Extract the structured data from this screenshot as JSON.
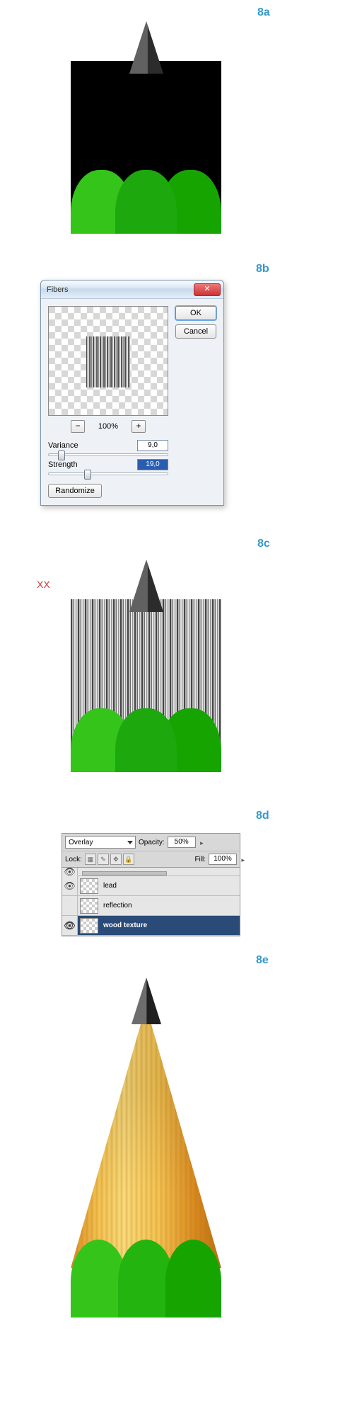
{
  "steps": {
    "a": "8a",
    "b": "8b",
    "c": "8c",
    "d": "8d",
    "e": "8e"
  },
  "annotation": {
    "xx": "XX"
  },
  "fibers_dialog": {
    "title": "Fibers",
    "close_glyph": "✕",
    "ok": "OK",
    "cancel": "Cancel",
    "zoom_minus": "−",
    "zoom_plus": "+",
    "zoom_value": "100%",
    "variance_label": "Variance",
    "variance_value": "9,0",
    "variance_thumb_pct": 8,
    "strength_label": "Strength",
    "strength_value": "19,0",
    "strength_thumb_pct": 30,
    "randomize": "Randomize"
  },
  "layers_panel": {
    "blend_mode": "Overlay",
    "opacity_label": "Opacity:",
    "opacity_value": "50%",
    "lock_label": "Lock:",
    "fill_label": "Fill:",
    "fill_value": "100%",
    "lock_icons": {
      "pixels": "▦",
      "position": "✎",
      "move": "✥",
      "all": "🔒"
    },
    "eye_glyph": "👁",
    "layers": [
      {
        "name": "lead",
        "visible": true,
        "selected": false
      },
      {
        "name": "reflection",
        "visible": false,
        "selected": false
      },
      {
        "name": "wood texture",
        "visible": true,
        "selected": true
      }
    ]
  }
}
